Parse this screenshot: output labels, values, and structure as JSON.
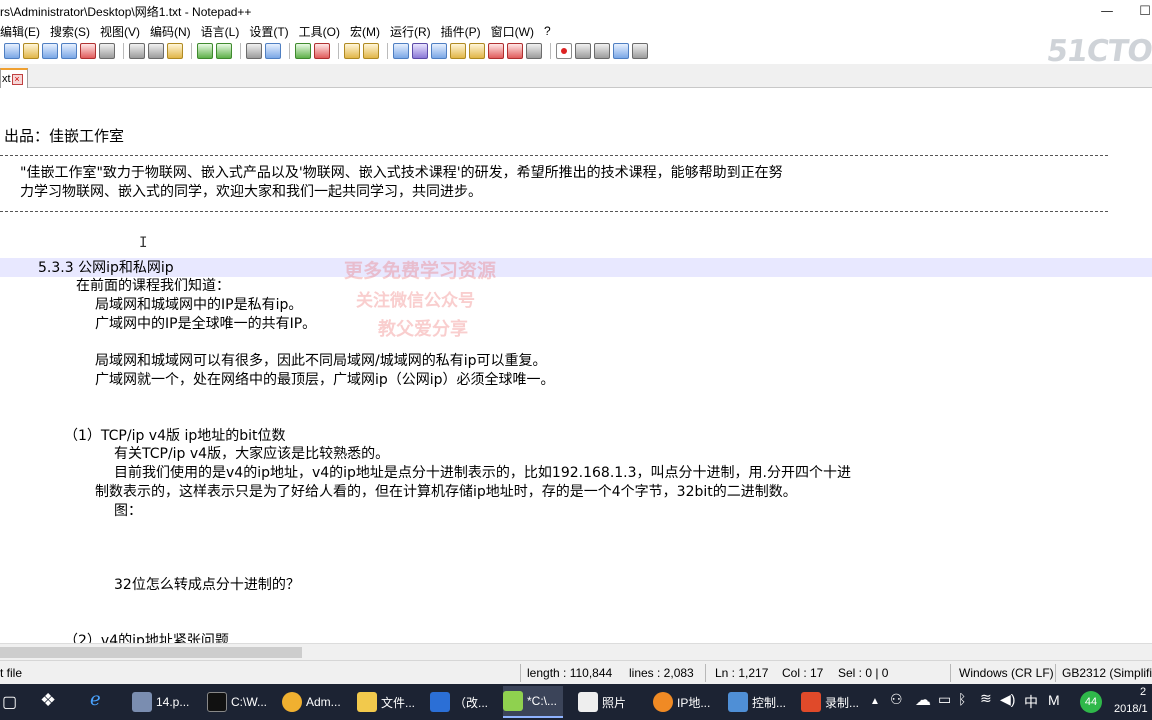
{
  "window": {
    "title": "rs\\Administrator\\Desktop\\网络1.txt - Notepad++",
    "minimize_glyph": "—",
    "maximize_glyph": "☐"
  },
  "menu": [
    "编辑(E)",
    "搜索(S)",
    "视图(V)",
    "编码(N)",
    "语言(L)",
    "设置(T)",
    "工具(O)",
    "宏(M)",
    "运行(R)",
    "插件(P)",
    "窗口(W)",
    "?"
  ],
  "logo_text": "51CTO",
  "tab": {
    "label": "xt",
    "close_glyph": "×"
  },
  "editor": {
    "lines": [
      {
        "text": "出品：佳嵌工作室"
      },
      {
        "text": "\"佳嵌工作室\"致力于物联网、嵌入式产品以及'物联网、嵌入式技术课程'的研发，希望所推出的技术课程，能够帮助到正在努"
      },
      {
        "text": "力学习物联网、嵌入式的同学，欢迎大家和我们一起共同学习，共同进步。"
      },
      {
        "text": "5.3.3 公网ip和私网ip"
      },
      {
        "text": "在前面的课程我们知道："
      },
      {
        "text": "局域网和城域网中的IP是私有ip。"
      },
      {
        "text": "广域网中的IP是全球唯一的共有IP。"
      },
      {
        "text": "局域网和城域网可以有很多，因此不同局域网/城域网的私有ip可以重复。"
      },
      {
        "text": "广域网就一个，处在网络中的最顶层，广域网ip（公网ip）必须全球唯一。"
      },
      {
        "text": "（1）TCP/ip v4版 ip地址的bit位数"
      },
      {
        "text": "有关TCP/ip v4版，大家应该是比较熟悉的。"
      },
      {
        "text": "目前我们使用的是v4的ip地址，v4的ip地址是点分十进制表示的，比如192.168.1.3，叫点分十进制，用.分开四个十进"
      },
      {
        "text": "制数表示的，这样表示只是为了好给人看的，但在计算机存储ip地址时，存的是一个4个字节，32bit的二进制数。"
      },
      {
        "text": "图："
      },
      {
        "text": "32位怎么转成点分十进制的？"
      },
      {
        "text": "（2）v4的ip地址紧张问题"
      }
    ],
    "cursor_glyph": "I"
  },
  "watermark": {
    "line1": "更多免费学习资源",
    "line2": "关注微信公众号",
    "line3": "教父爱分享"
  },
  "status": {
    "type": "t file",
    "length": "length : 110,844",
    "lines": "lines : 2,083",
    "ln": "Ln : 1,217",
    "col": "Col : 17",
    "sel": "Sel : 0 | 0",
    "eol": "Windows (CR LF)",
    "encoding": "GB2312 (Simplified)"
  },
  "taskbar": {
    "items": [
      {
        "label": "14.p..."
      },
      {
        "label": "C:\\W..."
      },
      {
        "label": "Adm..."
      },
      {
        "label": "文件..."
      },
      {
        "label": "（改..."
      },
      {
        "label": "*C:\\..."
      },
      {
        "label": "照片"
      },
      {
        "label": "IP地..."
      },
      {
        "label": "控制..."
      },
      {
        "label": "录制..."
      }
    ],
    "badge": "44",
    "ime": "中",
    "ime2": "M",
    "clock_time": "2",
    "clock_date": "2018/1"
  }
}
